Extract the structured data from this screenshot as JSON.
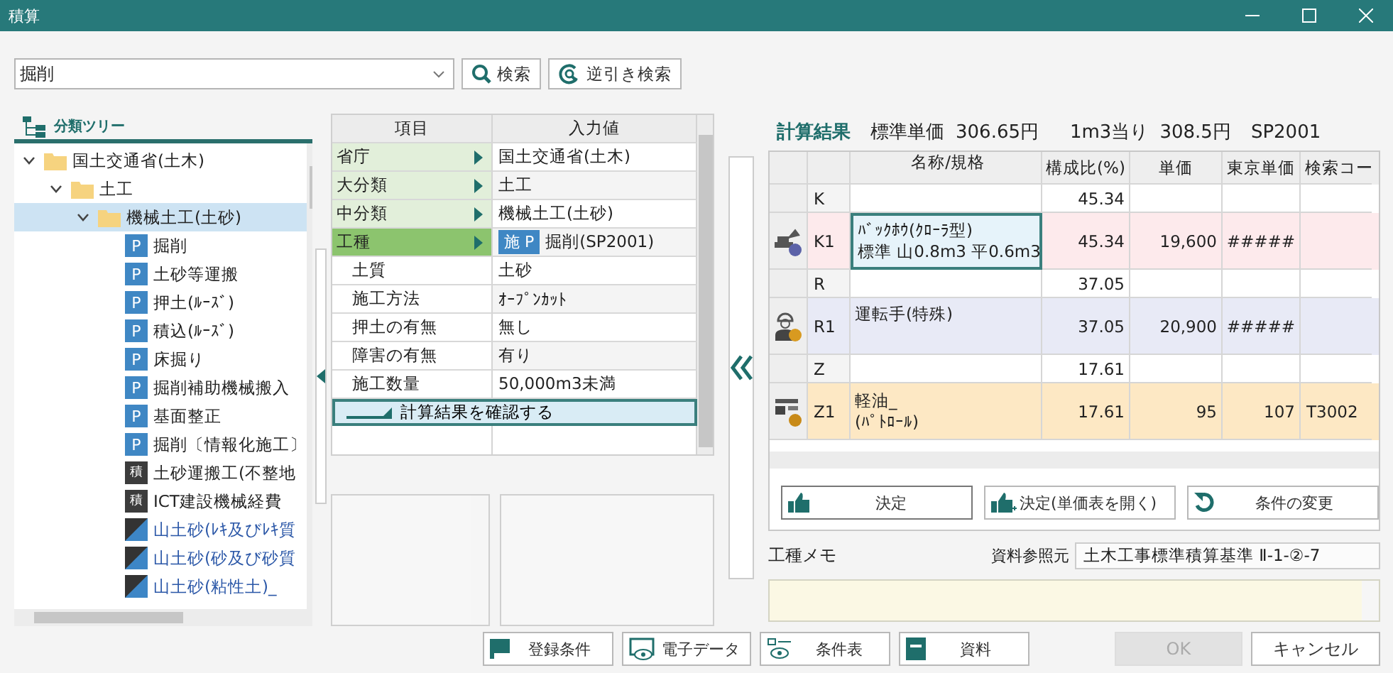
{
  "window": {
    "title": "積算"
  },
  "search": {
    "value": "掘削",
    "buttons": [
      {
        "kind": "search",
        "label": "検索"
      },
      {
        "kind": "reverse",
        "label": "逆引き検索"
      }
    ]
  },
  "tree": {
    "title": "分類ツリー",
    "items": [
      {
        "label": "国土交通省(土木)",
        "kind": "folder",
        "expanded": true,
        "selected": false,
        "children": [
          {
            "label": "土工",
            "kind": "folder",
            "expanded": true,
            "selected": false,
            "children": [
              {
                "label": "機械土工(土砂)",
                "kind": "folder",
                "expanded": true,
                "selected": true,
                "children": [
                  {
                    "label": "掘削",
                    "kind": "item",
                    "badge": "P",
                    "selected": false
                  },
                  {
                    "label": "土砂等運搬",
                    "kind": "item",
                    "badge": "P",
                    "selected": false
                  },
                  {
                    "label": "押土(ﾙｰｽﾞ)",
                    "kind": "item",
                    "badge": "P",
                    "selected": false
                  },
                  {
                    "label": "積込(ﾙｰｽﾞ)",
                    "kind": "item",
                    "badge": "P",
                    "selected": false
                  },
                  {
                    "label": "床掘り",
                    "kind": "item",
                    "badge": "P",
                    "selected": false
                  },
                  {
                    "label": "掘削補助機械搬入",
                    "kind": "item",
                    "badge": "P",
                    "selected": false
                  },
                  {
                    "label": "基面整正",
                    "kind": "item",
                    "badge": "P",
                    "selected": false
                  },
                  {
                    "label": "掘削〔情報化施工〕",
                    "kind": "item",
                    "badge": "P",
                    "selected": false
                  },
                  {
                    "label": "土砂運搬工(不整地",
                    "kind": "estimate",
                    "badge": "積",
                    "selected": false
                  },
                  {
                    "label": "ICT建設機械経費",
                    "kind": "estimate",
                    "badge": "積",
                    "selected": false
                  },
                  {
                    "label": "山土砂(ﾚｷ及びﾚｷ質",
                    "kind": "link",
                    "selected": false
                  },
                  {
                    "label": "山土砂(砂及び砂質",
                    "kind": "link",
                    "selected": false
                  },
                  {
                    "label": "山土砂(粘性土)_",
                    "kind": "link",
                    "selected": false
                  }
                ]
              }
            ]
          }
        ]
      }
    ]
  },
  "conditions": {
    "columns": [
      "項目",
      "入力値"
    ],
    "rows": [
      {
        "kind": "category",
        "label": "省庁",
        "value": "国土交通省(土木)",
        "selected": false
      },
      {
        "kind": "category",
        "label": "大分類",
        "value": "土工",
        "selected": false
      },
      {
        "kind": "category",
        "label": "中分類",
        "value": "機械土工(土砂)",
        "selected": false
      },
      {
        "kind": "category",
        "label": "工種",
        "value": "掘削(SP2001)",
        "badge": "施 P",
        "selected": true
      },
      {
        "kind": "param",
        "label": "土質",
        "value": "土砂",
        "selected": false
      },
      {
        "kind": "param",
        "label": "施工方法",
        "value": "ｵｰﾌﾟﾝｶｯﾄ",
        "selected": false
      },
      {
        "kind": "param",
        "label": "押土の有無",
        "value": "無し",
        "selected": false
      },
      {
        "kind": "param",
        "label": "障害の有無",
        "value": "有り",
        "selected": false
      },
      {
        "kind": "param",
        "label": "施工数量",
        "value": "50,000m3未満",
        "selected": false
      }
    ],
    "confirm": "計算結果を確認する"
  },
  "results": {
    "title": "計算結果",
    "standard_label": "標準単価",
    "standard_value": "306.65円",
    "per_label": "1m3当り",
    "per_value": "308.5円",
    "code": "SP2001",
    "columns": [
      "名称/規格",
      "構成比(%)",
      "単価",
      "東京単価",
      "検索コー"
    ],
    "rows": [
      {
        "kind": "group",
        "code": "K",
        "ratio": "45.34",
        "selected": false
      },
      {
        "kind": "machine",
        "code": "K1",
        "name": [
          "ﾊﾞｯｸﾎｳ(ｸﾛｰﾗ型)",
          "標準 山0.8m3 平0.6m3"
        ],
        "ratio": "45.34",
        "price": "19,600",
        "tokyo": "#####",
        "selected": true
      },
      {
        "kind": "group",
        "code": "R",
        "ratio": "37.05",
        "selected": false
      },
      {
        "kind": "labor",
        "code": "R1",
        "name": [
          "運転手(特殊)"
        ],
        "ratio": "37.05",
        "price": "20,900",
        "tokyo": "#####",
        "selected": false
      },
      {
        "kind": "group",
        "code": "Z",
        "ratio": "17.61",
        "selected": false
      },
      {
        "kind": "material",
        "code": "Z1",
        "name": [
          "軽油_",
          "(ﾊﾟﾄﾛｰﾙ)"
        ],
        "ratio": "17.61",
        "price": "95",
        "tokyo": "107",
        "search_code": "T3002",
        "selected": false
      }
    ],
    "buttons": [
      {
        "kind": "decide",
        "label": "決定"
      },
      {
        "kind": "decide_open",
        "label": "決定(単価表を開く)"
      },
      {
        "kind": "change",
        "label": "条件の変更"
      }
    ]
  },
  "memo": {
    "label": "工種メモ",
    "source_label": "資料参照元",
    "source_value": "土木工事標準積算基準 Ⅱ-1-②-7"
  },
  "footer": [
    {
      "kind": "flag",
      "label": "登録条件",
      "disabled": false
    },
    {
      "kind": "data",
      "label": "電子データ",
      "disabled": false
    },
    {
      "kind": "table",
      "label": "条件表",
      "disabled": false
    },
    {
      "kind": "book",
      "label": "資料",
      "disabled": false
    },
    {
      "kind": "ok",
      "label": "OK",
      "disabled": true
    },
    {
      "kind": "cancel",
      "label": "キャンセル",
      "disabled": false
    }
  ]
}
